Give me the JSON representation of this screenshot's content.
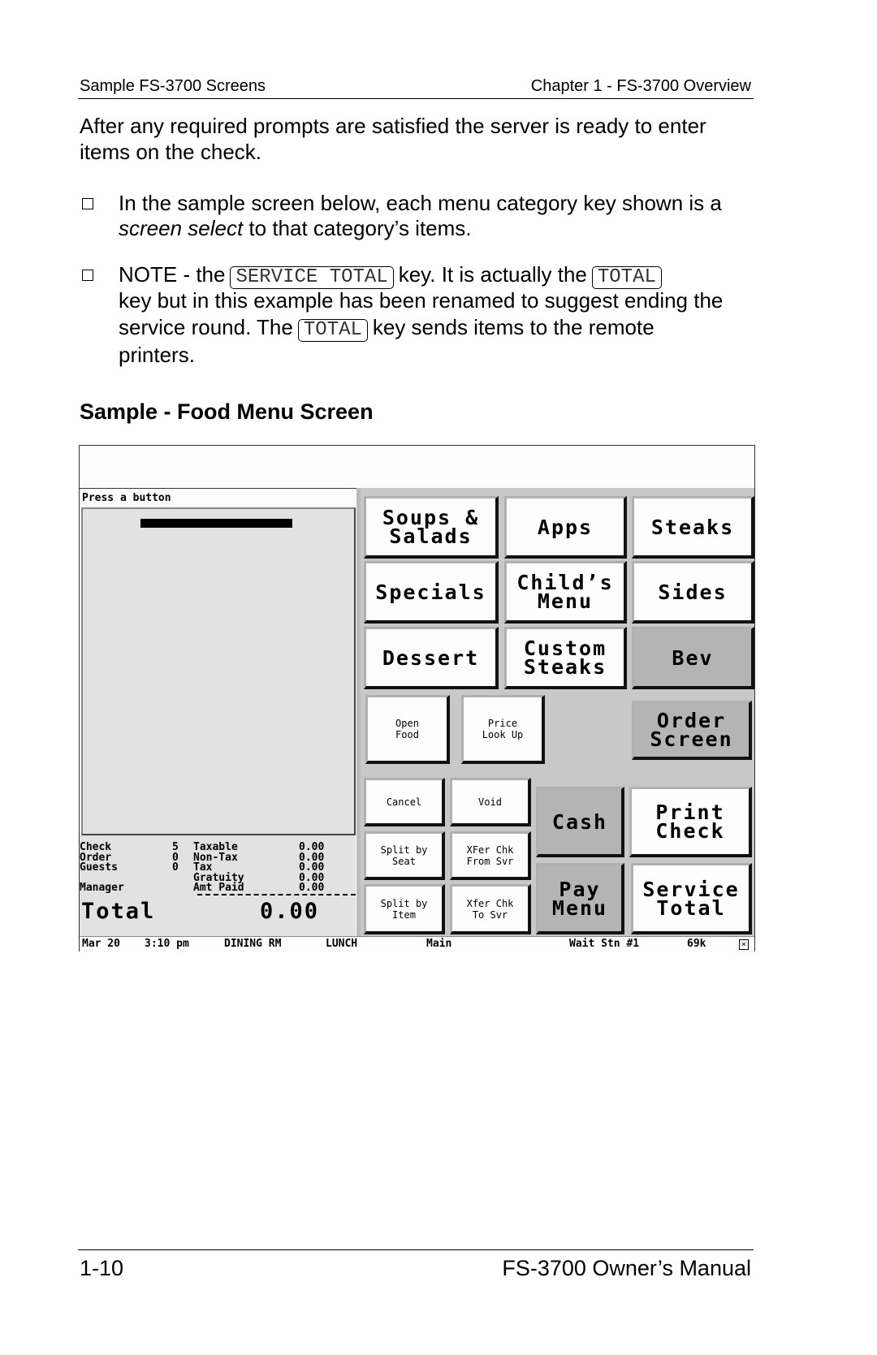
{
  "header": {
    "left": "Sample FS-3700 Screens",
    "right": "Chapter 1 - FS-3700 Overview"
  },
  "intro": [
    "After any required prompts are satisfied the server is ready to enter",
    "items on the check."
  ],
  "bullet1": {
    "line1": "In the sample screen below, each menu category key shown is a",
    "line2_italic": "screen select",
    "line2_rest": " to that category’s items."
  },
  "bullet2": {
    "l1_a": "NOTE - the",
    "key_service_total": "SERVICE TOTAL",
    "l1_b": "key.  It is actually the",
    "key_total": "TOTAL",
    "l2": "key but in this example has been renamed to suggest ending the",
    "l3_a": "service round.  The",
    "l3_b": "key sends items to the remote",
    "l4": "printers."
  },
  "section_heading": "Sample - Food Menu Screen",
  "pos": {
    "prompt": "Press a button",
    "summary_left": [
      {
        "label": "Check",
        "value": "5"
      },
      {
        "label": "Order",
        "value": "0"
      },
      {
        "label": "Guests",
        "value": "0"
      },
      {
        "label": "",
        "value": ""
      },
      {
        "label": "Manager",
        "value": ""
      }
    ],
    "summary_right": [
      {
        "label": "Taxable",
        "value": "0.00"
      },
      {
        "label": "Non-Tax",
        "value": "0.00"
      },
      {
        "label": "Tax",
        "value": "0.00"
      },
      {
        "label": "Gratuity",
        "value": "0.00"
      },
      {
        "label": "Amt Paid",
        "value": "0.00"
      }
    ],
    "total_label": "Total",
    "total_value": "0.00",
    "status": {
      "date": "Mar 20",
      "time": "3:10 pm",
      "area": "DINING RM",
      "meal": "LUNCH",
      "screen": "Main",
      "station": "Wait Stn #1",
      "memory": "69k"
    },
    "buttons": {
      "soups": "Soups &\nSalads",
      "apps": "Apps",
      "steaks": "Steaks",
      "specials": "Specials",
      "childs": "Child’s\nMenu",
      "sides": "Sides",
      "dessert": "Dessert",
      "custom": "Custom\nSteaks",
      "bev": "Bev",
      "open_food": "Open\nFood",
      "plu": "Price\nLook Up",
      "order_screen": "Order\nScreen",
      "cancel": "Cancel",
      "void": "Void",
      "cash": "Cash",
      "print_check": "Print\nCheck",
      "split_seat": "Split by\nSeat",
      "xfer_from": "XFer Chk\nFrom Svr",
      "split_item": "Split by\nItem",
      "xfer_to": "Xfer Chk\nTo Svr",
      "pay_menu": "Pay\nMenu",
      "service_total": "Service\nTotal"
    }
  },
  "footer": {
    "left": "1-10",
    "right": "FS-3700 Owner’s Manual"
  }
}
